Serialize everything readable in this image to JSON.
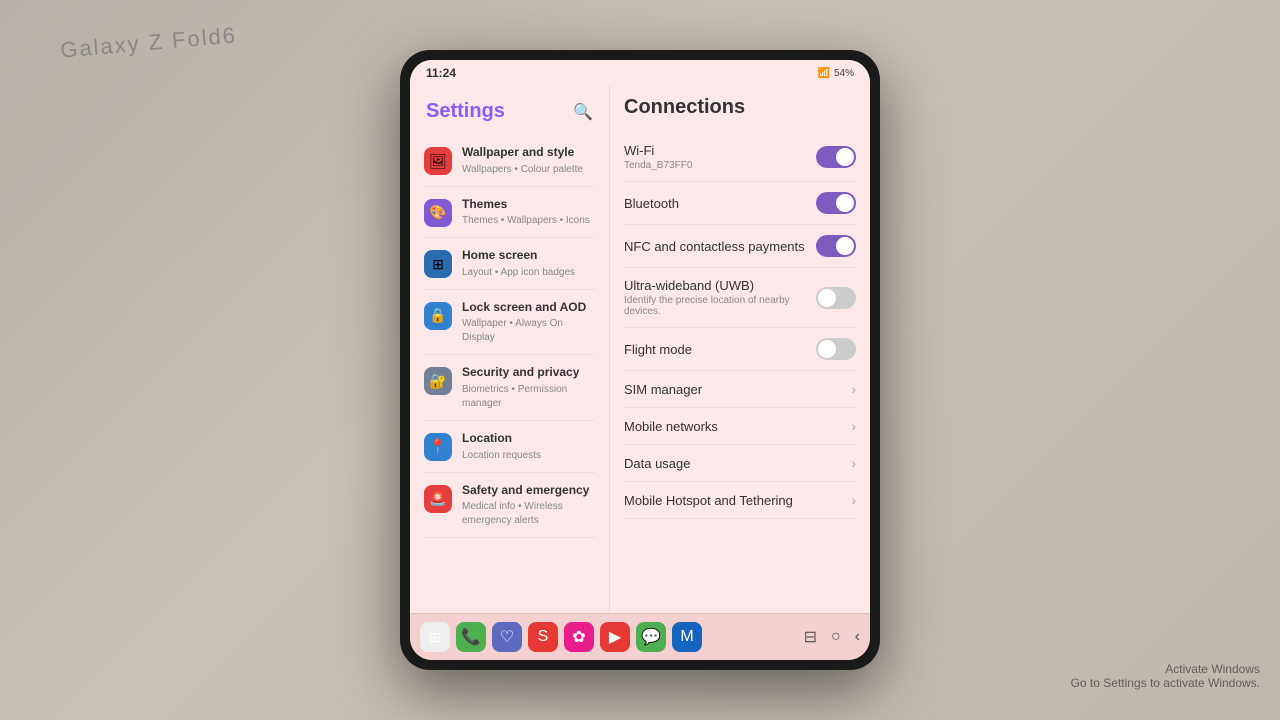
{
  "background": {
    "galaxy_label": "Galaxy Z Fold6"
  },
  "activate_windows": {
    "line1": "Activate Windows",
    "line2": "Go to Settings to activate Windows."
  },
  "status_bar": {
    "time": "11:24",
    "battery": "54%",
    "signal": "▌▌▌"
  },
  "settings": {
    "title": "Settings",
    "search_icon": "🔍",
    "menu_items": [
      {
        "id": "wallpaper",
        "label": "Wallpaper and style",
        "sublabel": "Wallpapers • Colour palette",
        "icon_color": "red",
        "icon": "🖼"
      },
      {
        "id": "themes",
        "label": "Themes",
        "sublabel": "Themes • Wallpapers • Icons",
        "icon_color": "purple",
        "icon": "🎨"
      },
      {
        "id": "home",
        "label": "Home screen",
        "sublabel": "Layout • App icon badges",
        "icon_color": "blue-dark",
        "icon": "⊞"
      },
      {
        "id": "lock",
        "label": "Lock screen and AOD",
        "sublabel": "Wallpaper • Always On Display",
        "icon_color": "blue",
        "icon": "🔒"
      },
      {
        "id": "security",
        "label": "Security and privacy",
        "sublabel": "Biometrics • Permission manager",
        "icon_color": "gray",
        "icon": "🔐"
      },
      {
        "id": "location",
        "label": "Location",
        "sublabel": "Location requests",
        "icon_color": "blue",
        "icon": "📍"
      },
      {
        "id": "safety",
        "label": "Safety and emergency",
        "sublabel": "Medical info • Wireless emergency alerts",
        "icon_color": "red",
        "icon": "🚨"
      }
    ]
  },
  "connections": {
    "title": "Connections",
    "items": [
      {
        "id": "wifi",
        "label": "Wi-Fi",
        "sublabel": "Tenda_B73FF0",
        "has_toggle": true,
        "toggle_on": true
      },
      {
        "id": "bluetooth",
        "label": "Bluetooth",
        "sublabel": "",
        "has_toggle": true,
        "toggle_on": true
      },
      {
        "id": "nfc",
        "label": "NFC and contactless payments",
        "sublabel": "",
        "has_toggle": true,
        "toggle_on": true
      },
      {
        "id": "uwb",
        "label": "Ultra-wideband (UWB)",
        "sublabel": "Identify the precise location of nearby devices.",
        "has_toggle": true,
        "toggle_on": false
      },
      {
        "id": "flight",
        "label": "Flight mode",
        "sublabel": "",
        "has_toggle": true,
        "toggle_on": false
      },
      {
        "id": "sim",
        "label": "SIM manager",
        "sublabel": "",
        "has_toggle": false,
        "toggle_on": false
      },
      {
        "id": "mobile",
        "label": "Mobile networks",
        "sublabel": "",
        "has_toggle": false,
        "toggle_on": false
      },
      {
        "id": "data",
        "label": "Data usage",
        "sublabel": "",
        "has_toggle": false,
        "toggle_on": false
      },
      {
        "id": "hotspot",
        "label": "Mobile Hotspot and Tethering",
        "sublabel": "",
        "has_toggle": false,
        "toggle_on": false
      }
    ]
  },
  "dock": {
    "apps": [
      {
        "id": "grid",
        "icon": "⊞",
        "color": "grid"
      },
      {
        "id": "phone",
        "icon": "📞",
        "color": "phone"
      },
      {
        "id": "social1",
        "icon": "♡",
        "color": "blue-app"
      },
      {
        "id": "social2",
        "icon": "S",
        "color": "red-app"
      },
      {
        "id": "social3",
        "icon": "✿",
        "color": "pink-app"
      },
      {
        "id": "youtube",
        "icon": "▶",
        "color": "yt"
      },
      {
        "id": "whatsapp",
        "icon": "📱",
        "color": "wa"
      },
      {
        "id": "microsoft",
        "icon": "M",
        "color": "ms"
      }
    ],
    "nav_buttons": [
      "⊞",
      "◯",
      "‹"
    ]
  }
}
